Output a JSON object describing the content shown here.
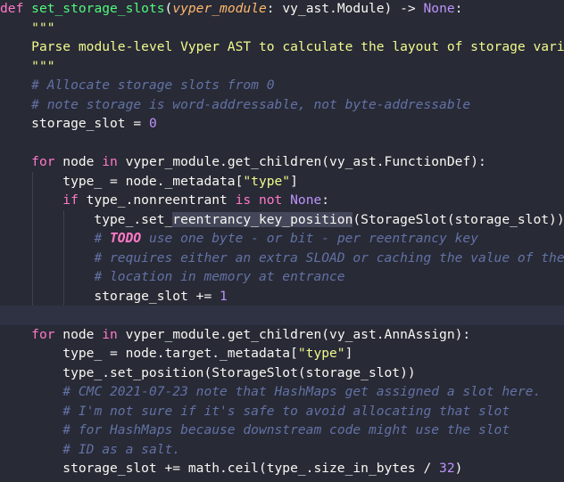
{
  "editor": {
    "colors": {
      "background": "#282a36",
      "keyword": "#ff79c6",
      "function": "#50fa7b",
      "string": "#f1fa8c",
      "number": "#bd93f9",
      "comment": "#6272a4",
      "default": "#f8f8f2",
      "selection": "#44475a"
    },
    "lines": [
      {
        "tokens": [
          [
            "kw",
            "def "
          ],
          [
            "fn",
            "set_storage_slots"
          ],
          [
            "ident",
            "("
          ],
          [
            "param",
            "vyper_module"
          ],
          [
            "ident",
            ": vy_ast.Module) -> "
          ],
          [
            "const",
            "None"
          ],
          [
            "ident",
            ":"
          ]
        ]
      },
      {
        "tokens": [
          [
            "ident",
            "    "
          ],
          [
            "str",
            "\"\"\""
          ]
        ]
      },
      {
        "tokens": [
          [
            "ident",
            "    "
          ],
          [
            "str",
            "Parse module-level Vyper AST to calculate the layout of storage variables."
          ]
        ]
      },
      {
        "tokens": [
          [
            "ident",
            "    "
          ],
          [
            "str",
            "\"\"\""
          ]
        ]
      },
      {
        "tokens": [
          [
            "ident",
            "    "
          ],
          [
            "comment",
            "# Allocate storage slots from 0"
          ]
        ]
      },
      {
        "tokens": [
          [
            "ident",
            "    "
          ],
          [
            "comment",
            "# note storage is word-addressable, not byte-addressable"
          ]
        ]
      },
      {
        "tokens": [
          [
            "ident",
            "    storage_slot = "
          ],
          [
            "num",
            "0"
          ]
        ]
      },
      {
        "tokens": []
      },
      {
        "tokens": [
          [
            "ident",
            "    "
          ],
          [
            "kw",
            "for"
          ],
          [
            "ident",
            " node "
          ],
          [
            "kw",
            "in"
          ],
          [
            "ident",
            " vyper_module.get_children(vy_ast.FunctionDef):"
          ]
        ]
      },
      {
        "tokens": [
          [
            "ident",
            "        type_ = node._metadata["
          ],
          [
            "str",
            "\"type\""
          ],
          [
            "ident",
            "]"
          ]
        ]
      },
      {
        "tokens": [
          [
            "ident",
            "        "
          ],
          [
            "kw",
            "if"
          ],
          [
            "ident",
            " type_.nonreentrant "
          ],
          [
            "kw",
            "is not"
          ],
          [
            "ident",
            " "
          ],
          [
            "const",
            "None"
          ],
          [
            "ident",
            ":"
          ]
        ]
      },
      {
        "tokens": [
          [
            "ident",
            "            type_.set_"
          ],
          [
            "hl",
            "reentrancy_key_position"
          ],
          [
            "ident",
            "(StorageSlot(storage_slot))"
          ]
        ]
      },
      {
        "tokens": [
          [
            "ident",
            "            "
          ],
          [
            "comment",
            "# "
          ],
          [
            "todo",
            "TODO"
          ],
          [
            "comment",
            " use one byte - or bit - per reentrancy key"
          ]
        ]
      },
      {
        "tokens": [
          [
            "ident",
            "            "
          ],
          [
            "comment",
            "# requires either an extra SLOAD or caching the value of the"
          ]
        ]
      },
      {
        "tokens": [
          [
            "ident",
            "            "
          ],
          [
            "comment",
            "# location in memory at entrance"
          ]
        ]
      },
      {
        "tokens": [
          [
            "ident",
            "            storage_slot += "
          ],
          [
            "num",
            "1"
          ]
        ]
      },
      {
        "tokens": [],
        "cursor": true
      },
      {
        "tokens": [
          [
            "ident",
            "    "
          ],
          [
            "kw",
            "for"
          ],
          [
            "ident",
            " node "
          ],
          [
            "kw",
            "in"
          ],
          [
            "ident",
            " vyper_module.get_children(vy_ast.AnnAssign):"
          ]
        ]
      },
      {
        "tokens": [
          [
            "ident",
            "        type_ = node.target._metadata["
          ],
          [
            "str",
            "\"type\""
          ],
          [
            "ident",
            "]"
          ]
        ]
      },
      {
        "tokens": [
          [
            "ident",
            "        type_.set_position(StorageSlot(storage_slot))"
          ]
        ]
      },
      {
        "tokens": [
          [
            "ident",
            "        "
          ],
          [
            "comment",
            "# CMC 2021-07-23 note that HashMaps get assigned a slot here."
          ]
        ]
      },
      {
        "tokens": [
          [
            "ident",
            "        "
          ],
          [
            "comment",
            "# I'm not sure if it's safe to avoid allocating that slot"
          ]
        ]
      },
      {
        "tokens": [
          [
            "ident",
            "        "
          ],
          [
            "comment",
            "# for HashMaps because downstream code might use the slot"
          ]
        ]
      },
      {
        "tokens": [
          [
            "ident",
            "        "
          ],
          [
            "comment",
            "# ID as a salt."
          ]
        ]
      },
      {
        "tokens": [
          [
            "ident",
            "        storage_slot += math.ceil(type_.size_in_bytes / "
          ],
          [
            "num",
            "32"
          ],
          [
            "ident",
            ")"
          ]
        ]
      }
    ]
  }
}
